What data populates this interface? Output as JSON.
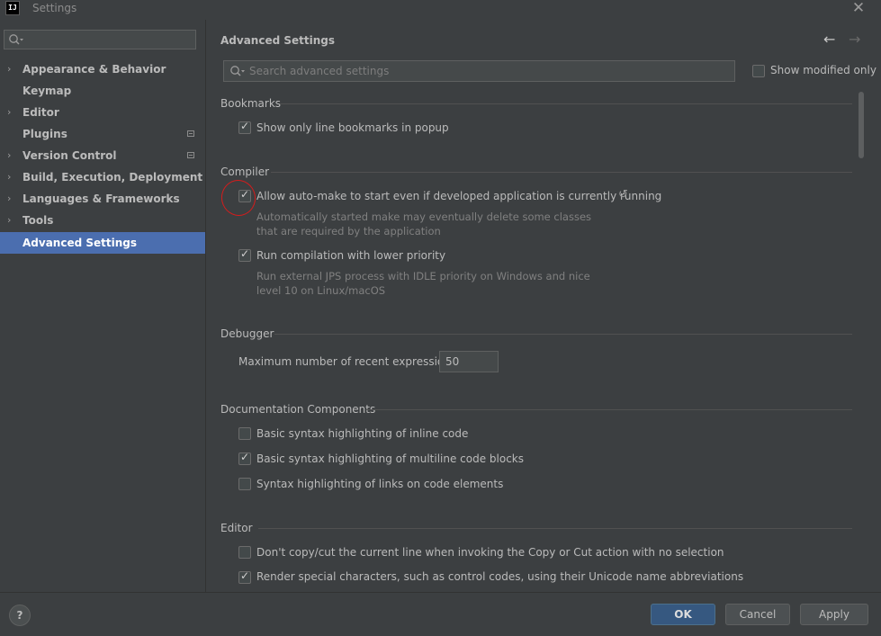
{
  "window": {
    "app_icon": "IJ",
    "title": "Settings",
    "close": "✕"
  },
  "sidebar": {
    "search_placeholder": "",
    "items": [
      {
        "label": "Appearance & Behavior",
        "arrow": "›"
      },
      {
        "label": "Keymap",
        "arrow": ""
      },
      {
        "label": "Editor",
        "arrow": "›"
      },
      {
        "label": "Plugins",
        "arrow": ""
      },
      {
        "label": "Version Control",
        "arrow": "›"
      },
      {
        "label": "Build, Execution, Deployment",
        "arrow": "›"
      },
      {
        "label": "Languages & Frameworks",
        "arrow": "›"
      },
      {
        "label": "Tools",
        "arrow": "›"
      },
      {
        "label": "Advanced Settings",
        "arrow": ""
      }
    ]
  },
  "main": {
    "title": "Advanced Settings",
    "nav_back": "←",
    "nav_forward": "→",
    "search_placeholder": "Search advanced settings",
    "show_modified_label": "Show modified only",
    "sections": {
      "bookmarks": {
        "title": "Bookmarks",
        "line_bookmarks": "Show only line bookmarks in popup"
      },
      "compiler": {
        "title": "Compiler",
        "auto_make": "Allow auto-make to start even if developed application is currently running",
        "auto_make_desc": "Automatically started make may eventually delete some classes that are required by the application",
        "low_priority": "Run compilation with lower priority",
        "low_priority_desc": "Run external JPS process with IDLE priority on Windows and nice level 10 on Linux/macOS",
        "reset_icon": "↺"
      },
      "debugger": {
        "title": "Debugger",
        "max_expr_label": "Maximum number of recent expressions:",
        "max_expr_value": "50"
      },
      "documentation": {
        "title": "Documentation Components",
        "inline": "Basic syntax highlighting of inline code",
        "multiline": "Basic syntax highlighting of multiline code blocks",
        "links": "Syntax highlighting of links on code elements"
      },
      "editor": {
        "title": "Editor",
        "no_copy": "Don't copy/cut the current line when invoking the Copy or Cut action with no selection",
        "special_chars": "Render special characters, such as control codes, using their Unicode name abbreviations"
      }
    }
  },
  "footer": {
    "help": "?",
    "ok": "OK",
    "cancel": "Cancel",
    "apply": "Apply"
  }
}
